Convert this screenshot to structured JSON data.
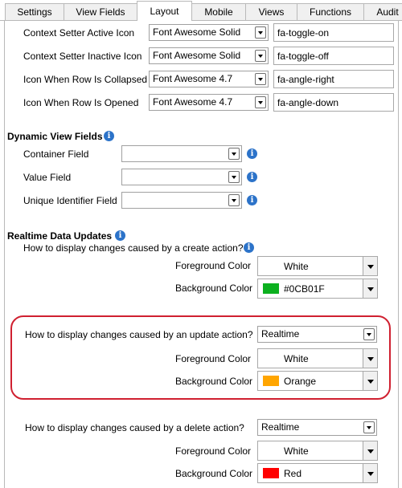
{
  "tabs": [
    "Settings",
    "View Fields",
    "Layout",
    "Mobile",
    "Views",
    "Functions",
    "Audit"
  ],
  "icon_settings": [
    {
      "label": "Context Setter Active Icon",
      "library": "Font Awesome Solid",
      "icon": "fa-toggle-on"
    },
    {
      "label": "Context Setter Inactive Icon",
      "library": "Font Awesome Solid",
      "icon": "fa-toggle-off"
    },
    {
      "label": "Icon When Row Is Collapsed",
      "library": "Font Awesome 4.7",
      "icon": "fa-angle-right"
    },
    {
      "label": "Icon When Row Is Opened",
      "library": "Font Awesome 4.7",
      "icon": "fa-angle-down"
    }
  ],
  "dynamic": {
    "title": "Dynamic View Fields",
    "fields": [
      {
        "label": "Container Field",
        "value": ""
      },
      {
        "label": "Value Field",
        "value": ""
      },
      {
        "label": "Unique Identifier Field",
        "value": ""
      }
    ]
  },
  "realtime": {
    "title": "Realtime Data Updates",
    "create_question": "How to display changes caused by a create action?",
    "update_question": "How to display changes caused by an update action?",
    "delete_question": "How to display changes caused by a delete action?",
    "update_mode": "Realtime",
    "delete_mode": "Realtime",
    "fg_label": "Foreground Color",
    "bg_label": "Background Color",
    "create_fg": "White",
    "create_bg": "#0CB01F",
    "update_fg": "White",
    "update_bg": "Orange",
    "delete_fg": "White",
    "delete_bg": "Red"
  },
  "colors": {
    "green": "#0CB01F",
    "orange": "#FFA500",
    "red": "#FF0000",
    "highlight": "#d02030",
    "info": "#2c73c9"
  }
}
